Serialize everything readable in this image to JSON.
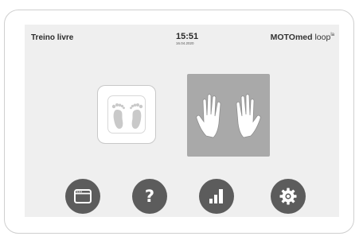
{
  "header": {
    "mode_title": "Treino livre",
    "time": "15:51",
    "date": "16.04.2020",
    "brand_bold": "MOTOmed",
    "brand_light": " loop",
    "brand_superscript": "la"
  },
  "modes": [
    {
      "name": "legs",
      "icon": "feet-icon",
      "selected": false
    },
    {
      "name": "arms",
      "icon": "hands-icon",
      "selected": true
    }
  ],
  "bottom_buttons": [
    {
      "icon": "window-icon"
    },
    {
      "icon": "help-icon",
      "glyph": "?"
    },
    {
      "icon": "bar-chart-icon"
    },
    {
      "icon": "gear-icon"
    }
  ],
  "colors": {
    "screen_bg": "#efefef",
    "selected_tile": "#a9a9a9",
    "button_bg": "#5c5c5c",
    "text_dark": "#2b2b2b"
  }
}
